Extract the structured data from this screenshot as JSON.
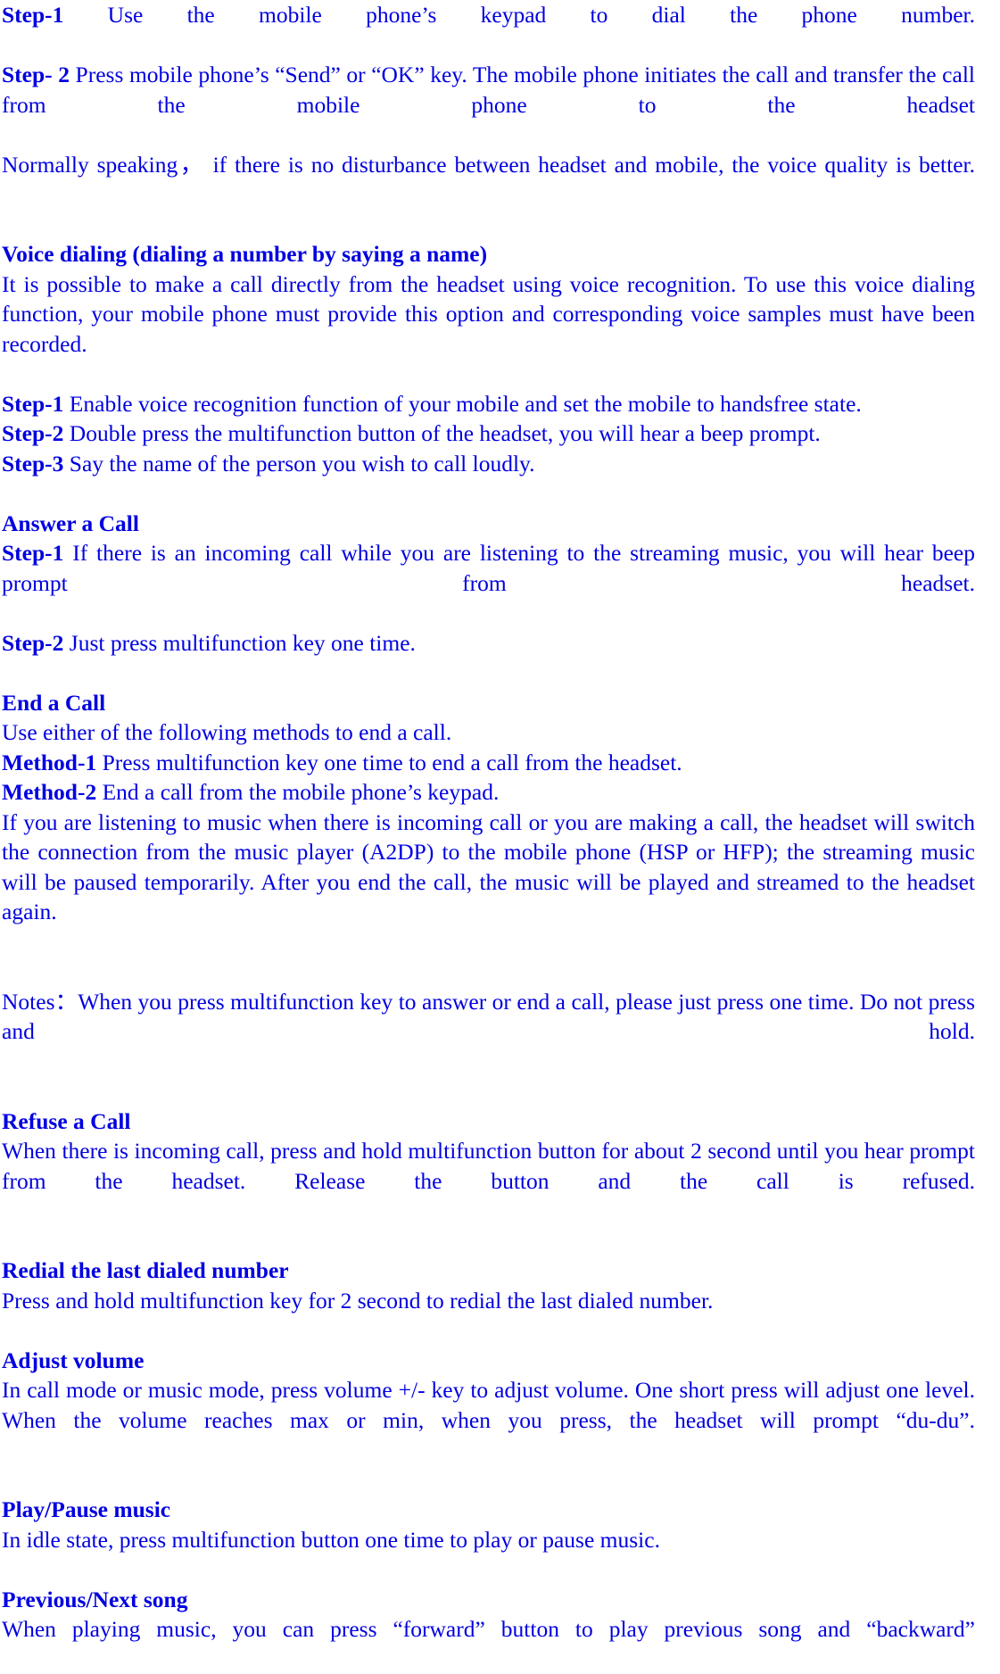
{
  "document": {
    "text_color": "#0000e0",
    "background_color": "#ffffff",
    "blocks": [
      {
        "id": "step1_dial",
        "lead": "Step-1",
        "body": "    Use the mobile phone’s keypad to dial the phone number."
      },
      {
        "id": "step2_send",
        "lead": "Step- 2",
        "body": " Press mobile phone’s “Send” or “OK” key. The mobile phone initiates the call and transfer the call from the mobile phone to the headset"
      },
      {
        "id": "normally_speaking",
        "body": "Normally speaking， if there is no disturbance between headset and mobile, the voice quality is better."
      },
      {
        "id": "voice_dialing_heading",
        "heading": "Voice dialing (dialing a number by saying a name)"
      },
      {
        "id": "voice_dialing_intro",
        "body": "It is possible to make a call directly from the headset using voice recognition. To use this voice dialing function, your mobile phone must provide this option and corresponding voice samples must have been recorded."
      },
      {
        "id": "vd_step1",
        "lead": "Step-1",
        "body": " Enable voice recognition function of your mobile and set the mobile to handsfree state."
      },
      {
        "id": "vd_step2",
        "lead": "Step-2",
        "body": " Double press the multifunction button of the headset, you will hear a beep prompt."
      },
      {
        "id": "vd_step3",
        "lead": "Step-3",
        "body": " Say the name of the person you wish to call loudly."
      },
      {
        "id": "answer_call_heading",
        "heading": "Answer a Call"
      },
      {
        "id": "ac_step1",
        "lead": "Step-1",
        "body": "    If there is an incoming call while you are listening to the streaming music, you will hear beep prompt from headset."
      },
      {
        "id": "ac_step2",
        "lead": "Step-2",
        "body": "    Just press multifunction key one time."
      },
      {
        "id": "end_call_heading",
        "heading": "End a Call"
      },
      {
        "id": "end_call_intro",
        "body": "Use either of the following methods to end a call."
      },
      {
        "id": "method1",
        "lead": "Method-1",
        "body": "    Press multifunction key one time to end a call from the headset."
      },
      {
        "id": "method2",
        "lead": "Method-2",
        "body": "    End a call from the mobile phone’s keypad."
      },
      {
        "id": "end_call_detail",
        "body": "If you are listening to music when there is incoming call or you are making a call, the headset will switch the connection from the music player (A2DP) to the mobile phone (HSP or HFP); the streaming music will be paused temporarily. After you end the call, the music will be played and streamed to the headset again."
      },
      {
        "id": "notes",
        "lead": "Notes：",
        "body": "When you press multifunction key to answer or end a call, please just press one time. Do not press and hold.",
        "lead_bold": false
      },
      {
        "id": "refuse_call_heading",
        "heading": "Refuse a Call"
      },
      {
        "id": "refuse_call_body",
        "body": "When there is incoming call, press and hold multifunction button for about 2 second until you hear prompt from the headset. Release the button and the call is refused."
      },
      {
        "id": "redial_heading",
        "heading": "Redial the last dialed number"
      },
      {
        "id": "redial_body",
        "body": "Press and hold multifunction key for 2 second to redial the last dialed number."
      },
      {
        "id": "adjust_volume_heading",
        "heading": "Adjust volume"
      },
      {
        "id": "adjust_volume_body",
        "body": "In call mode or music mode, press volume +/- key to adjust volume. One short press will adjust one level. When the volume reaches max or min, when you press, the headset will prompt “du-du”."
      },
      {
        "id": "play_pause_heading",
        "heading": "Play/Pause music"
      },
      {
        "id": "play_pause_body",
        "body": "In idle state, press multifunction button one time to play or pause music."
      },
      {
        "id": "prev_next_heading",
        "heading": "Previous/Next song"
      },
      {
        "id": "prev_next_body",
        "body": "When playing music, you can press “forward” button to play previous song and “backward”"
      }
    ]
  }
}
